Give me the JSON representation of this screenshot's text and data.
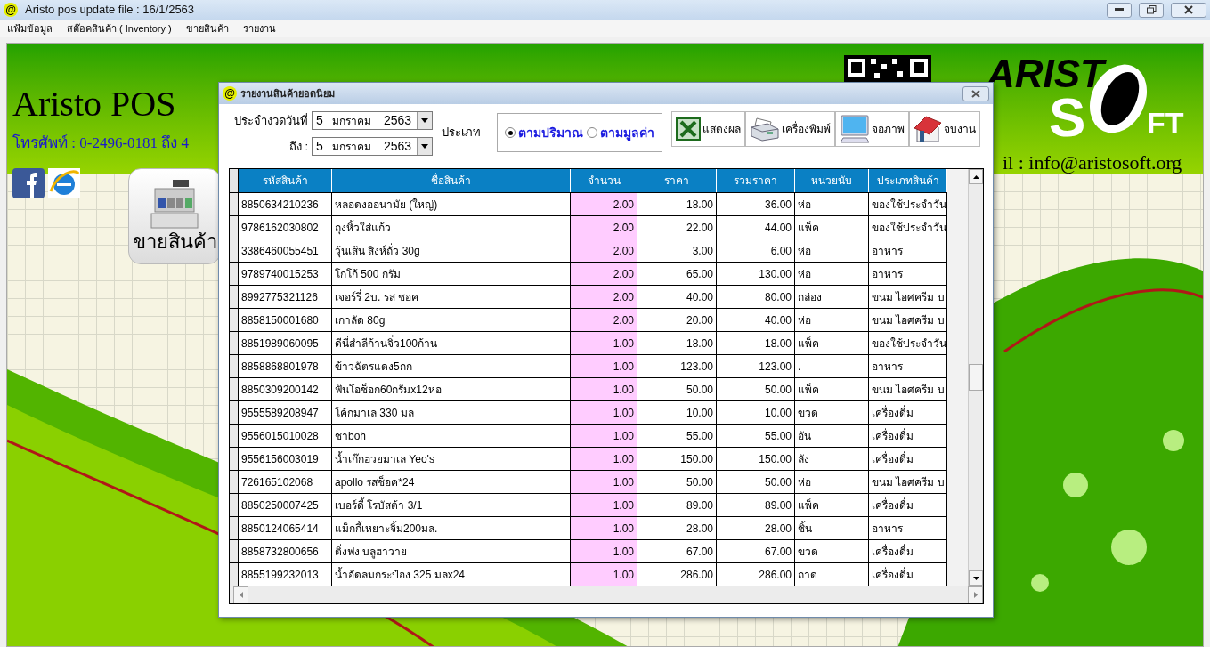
{
  "window": {
    "icon": "@",
    "title": "Aristo pos  update file : 16/1/2563"
  },
  "menu": [
    "แฟ้มข้อมูล",
    "สต๊อคสินค้า ( Inventory )",
    "ขายสินค้า",
    "รายงาน"
  ],
  "home": {
    "title": "Aristo POS",
    "phone": "โทรศัพท์ : 0-2496-0181 ถึง 4",
    "email": "il : info@aristosoft.org",
    "logo_top": "ARIST",
    "logo_s": "S",
    "logo_ft": "FT",
    "sell_button": "ขายสินค้า"
  },
  "dialog": {
    "icon": "@",
    "title": "รายงานสินค้ายอดนิยม",
    "from_label": "ประจำงวดวันที่",
    "from_date": {
      "day": "5",
      "month": "มกราคม",
      "year": "2563"
    },
    "to_label": "ถึง :",
    "to_date": {
      "day": "5",
      "month": "มกราคม",
      "year": "2563"
    },
    "type_label": "ประเภท",
    "options": [
      {
        "label": "ตามปริมาณ",
        "selected": true
      },
      {
        "label": "ตามมูลค่า",
        "selected": false
      }
    ],
    "buttons": [
      {
        "kind": "excel",
        "label": "แสดงผล"
      },
      {
        "kind": "printer",
        "label": "เครื่องพิมพ์"
      },
      {
        "kind": "monitor",
        "label": "จอภาพ"
      },
      {
        "kind": "home",
        "label": "จบงาน"
      }
    ],
    "table": {
      "columns": [
        "รหัสสินค้า",
        "ชื่อสินค้า",
        "จำนวน",
        "ราคา",
        "รวมราคา",
        "หน่วยนับ",
        "ประเภทสินค้า"
      ],
      "rows": [
        [
          "8850634210236",
          "หลอดงออนามัย (ใหญ่)",
          "2.00",
          "18.00",
          "36.00",
          "ห่อ",
          "ของใช้ประจำวัน"
        ],
        [
          "9786162030802",
          "ถุงหิ้วใส่แก้ว",
          "2.00",
          "22.00",
          "44.00",
          "แพ็ค",
          "ของใช้ประจำวัน"
        ],
        [
          "3386460055451",
          "วุ้นเส้น สิงห์ถั่ว 30g",
          "2.00",
          "3.00",
          "6.00",
          "ห่อ",
          "อาหาร"
        ],
        [
          "9789740015253",
          "โกโก้ 500 กรัม",
          "2.00",
          "65.00",
          "130.00",
          "ห่อ",
          "อาหาร"
        ],
        [
          "8992775321126",
          "เจอร์รี่ 2บ. รส ชอค",
          "2.00",
          "40.00",
          "80.00",
          "กล่อง",
          "ขนม ไอศครีม บ"
        ],
        [
          "8858150001680",
          "เกาลัด 80g",
          "2.00",
          "20.00",
          "40.00",
          "ห่อ",
          "ขนม ไอศครีม บ"
        ],
        [
          "8851989060095",
          "ดีนี่สำลีก้านจิ๋ว100ก้าน",
          "1.00",
          "18.00",
          "18.00",
          "แพ็ค",
          "ของใช้ประจำวัน"
        ],
        [
          "8858868801978",
          "ข้าวฉัตรแดง5กก",
          "1.00",
          "123.00",
          "123.00",
          ".",
          "อาหาร"
        ],
        [
          "8850309200142",
          "ฟันโอช็อก60กรัมx12ห่อ",
          "1.00",
          "50.00",
          "50.00",
          "แพ็ค",
          "ขนม ไอศครีม บ"
        ],
        [
          "9555589208947",
          "โค้กมาเล  330 มล",
          "1.00",
          "10.00",
          "10.00",
          "ขวด",
          "เครื่องดื่ม"
        ],
        [
          "9556015010028",
          "ชาboh",
          "1.00",
          "55.00",
          "55.00",
          "อัน",
          "เครื่องดื่ม"
        ],
        [
          "9556156003019",
          "น้ำเก๊กฮวยมาเล Yeo's",
          "1.00",
          "150.00",
          "150.00",
          "ลัง",
          "เครื่องดื่ม"
        ],
        [
          "726165102068",
          "apollo รสช็อค*24",
          "1.00",
          "50.00",
          "50.00",
          "ห่อ",
          "ขนม ไอศครีม บ"
        ],
        [
          "8850250007425",
          "เบอร์ดี้ โรบัสต้า 3/1",
          "1.00",
          "89.00",
          "89.00",
          "แพ็ค",
          "เครื่องดื่ม"
        ],
        [
          "8850124065414",
          "แม็กกี้เหยาะจิ้ม200มล.",
          "1.00",
          "28.00",
          "28.00",
          "ชิ้น",
          "อาหาร"
        ],
        [
          "8858732800656",
          "ติ่งฟง บลูฮาวาย",
          "1.00",
          "67.00",
          "67.00",
          "ขวด",
          "เครื่องดื่ม"
        ],
        [
          "8855199232013",
          "น้ำอัดลมกระป๋อง 325 มลx24",
          "1.00",
          "286.00",
          "286.00",
          "ถาด",
          "เครื่องดื่ม"
        ]
      ]
    }
  }
}
